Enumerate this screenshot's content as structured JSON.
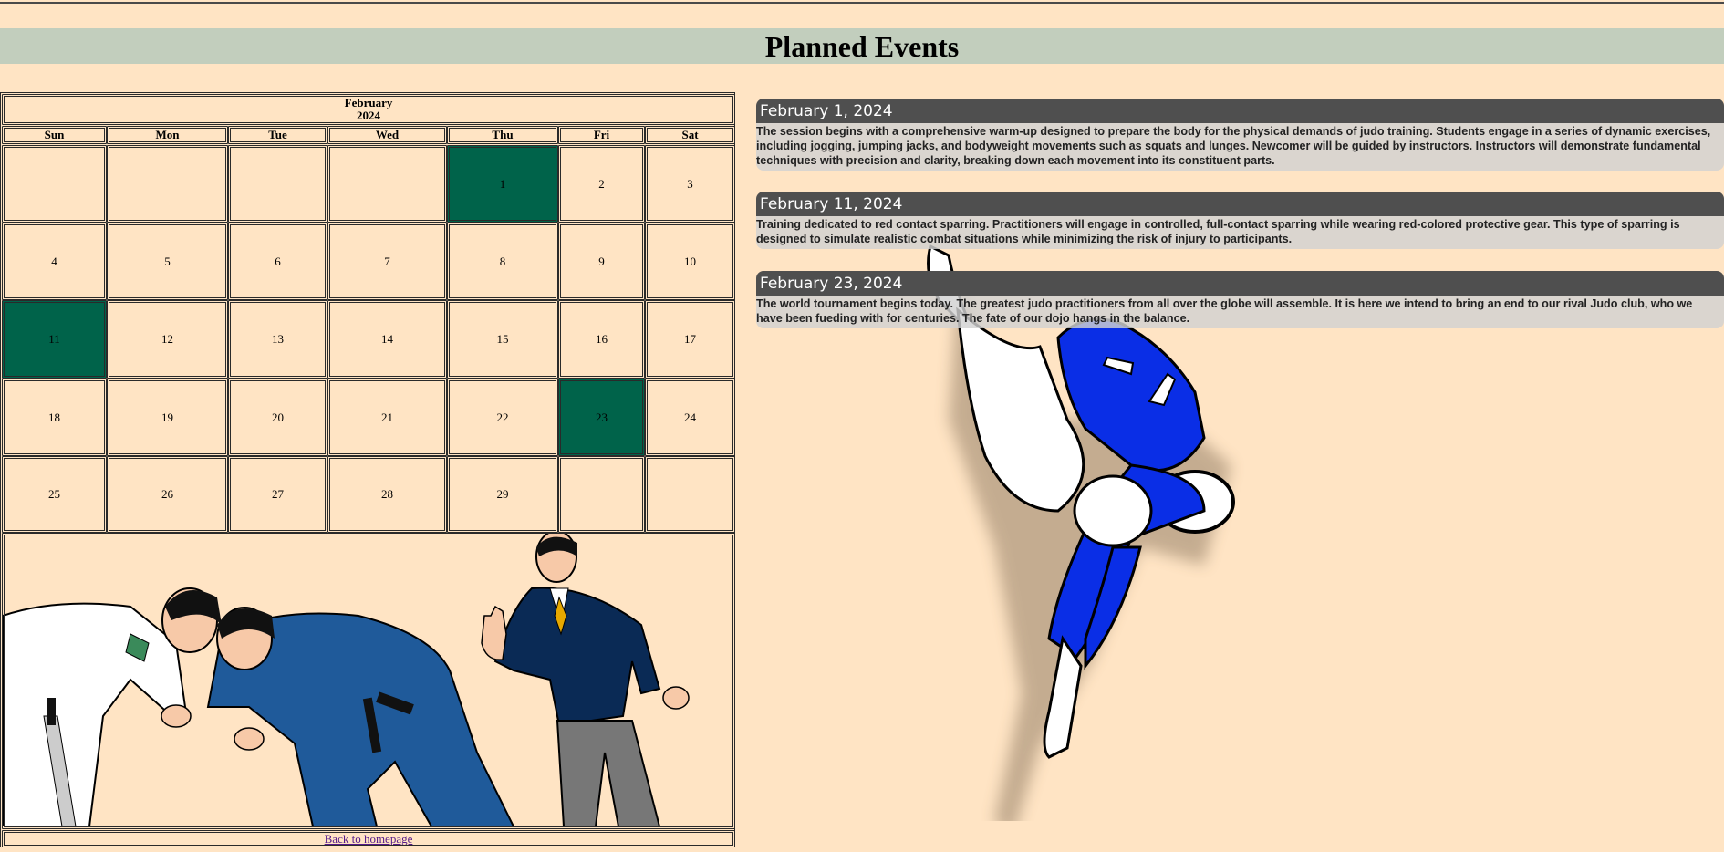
{
  "page": {
    "title": "Planned Events"
  },
  "calendar": {
    "month": "February",
    "year": "2024",
    "weekdays": [
      "Sun",
      "Mon",
      "Tue",
      "Wed",
      "Thu",
      "Fri",
      "Sat"
    ],
    "weeks": [
      [
        "",
        "",
        "",
        "",
        "1",
        "2",
        "3"
      ],
      [
        "4",
        "5",
        "6",
        "7",
        "8",
        "9",
        "10"
      ],
      [
        "11",
        "12",
        "13",
        "14",
        "15",
        "16",
        "17"
      ],
      [
        "18",
        "19",
        "20",
        "21",
        "22",
        "23",
        "24"
      ],
      [
        "25",
        "26",
        "27",
        "28",
        "29",
        "",
        ""
      ]
    ],
    "event_days": [
      "1",
      "11",
      "23"
    ],
    "event_color": "#00634a",
    "back_link": "Back to homepage"
  },
  "events": [
    {
      "date": "February 1, 2024",
      "description": "The session begins with a comprehensive warm-up designed to prepare the body for the physical demands of judo training. Students engage in a series of dynamic exercises, including jogging, jumping jacks, and bodyweight movements such as squats and lunges. Newcomer will be guided by instructors. Instructors will demonstrate fundamental techniques with precision and clarity, breaking down each movement into its constituent parts."
    },
    {
      "date": "February 11, 2024",
      "description": "Training dedicated to red contact sparring. Practitioners will engage in controlled, full-contact sparring while wearing red-colored protective gear. This type of sparring is designed to simulate realistic combat situations while minimizing the risk of injury to participants."
    },
    {
      "date": "February 23, 2024",
      "description": "The world tournament begins today. The greatest judo practitioners from all over the globe will assemble. It is here we intend to bring an end to our rival Judo club, who we have been fueding with for centuries. The fate of our dojo hangs in the balance."
    }
  ],
  "colors": {
    "background": "#ffe4c4",
    "title_bar": "#c2cebd",
    "event_header": "#4f4f4f",
    "judo_gi_blue": "#0a2ee6",
    "judo_gi_dark_blue": "#1f5a9a",
    "referee_suit": "#0a2a55"
  },
  "icons": [
    "judo-throw-illustration",
    "judo-match-illustration"
  ]
}
